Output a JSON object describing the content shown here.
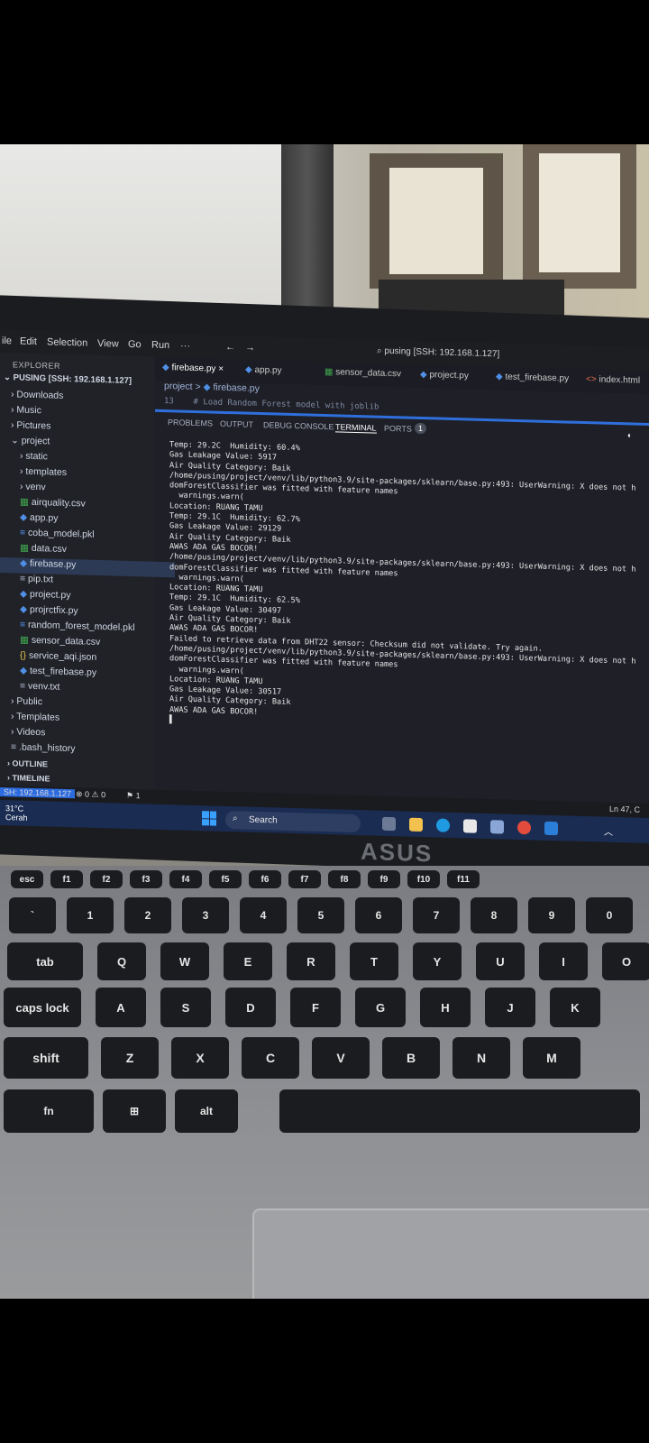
{
  "menubar": {
    "items": [
      "ile",
      "Edit",
      "Selection",
      "View",
      "Go",
      "Run",
      "···"
    ],
    "command_center": "pusing [SSH: 192.168.1.127]"
  },
  "explorer": {
    "title": "EXPLORER",
    "root": "PUSING [SSH: 192.168.1.127]",
    "items": [
      {
        "label": "Downloads",
        "kind": "folder",
        "indent": 1
      },
      {
        "label": "Music",
        "kind": "folder",
        "indent": 1
      },
      {
        "label": "Pictures",
        "kind": "folder",
        "indent": 1
      },
      {
        "label": "project",
        "kind": "folder-open",
        "indent": 1
      },
      {
        "label": "static",
        "kind": "folder",
        "indent": 2
      },
      {
        "label": "templates",
        "kind": "folder",
        "indent": 2
      },
      {
        "label": "venv",
        "kind": "folder",
        "indent": 2
      },
      {
        "label": "airquality.csv",
        "kind": "csv",
        "indent": 2
      },
      {
        "label": "app.py",
        "kind": "py",
        "indent": 2
      },
      {
        "label": "coba_model.pkl",
        "kind": "pkl",
        "indent": 2
      },
      {
        "label": "data.csv",
        "kind": "csv",
        "indent": 2
      },
      {
        "label": "firebase.py",
        "kind": "py",
        "indent": 2,
        "selected": true
      },
      {
        "label": "pip.txt",
        "kind": "txt",
        "indent": 2
      },
      {
        "label": "project.py",
        "kind": "py",
        "indent": 2
      },
      {
        "label": "projrctfix.py",
        "kind": "py",
        "indent": 2
      },
      {
        "label": "random_forest_model.pkl",
        "kind": "pkl",
        "indent": 2
      },
      {
        "label": "sensor_data.csv",
        "kind": "csv",
        "indent": 2
      },
      {
        "label": "service_aqi.json",
        "kind": "json",
        "indent": 2
      },
      {
        "label": "test_firebase.py",
        "kind": "py",
        "indent": 2
      },
      {
        "label": "venv.txt",
        "kind": "txt",
        "indent": 2
      },
      {
        "label": "Public",
        "kind": "folder",
        "indent": 1
      },
      {
        "label": "Templates",
        "kind": "folder",
        "indent": 1
      },
      {
        "label": "Videos",
        "kind": "folder",
        "indent": 1
      },
      {
        "label": ".bash_history",
        "kind": "txt",
        "indent": 1
      }
    ],
    "outline": "OUTLINE",
    "timeline": "TIMELINE"
  },
  "tabs": [
    {
      "label": "firebase.py",
      "active": true,
      "close": "×"
    },
    {
      "label": "app.py"
    },
    {
      "label": "sensor_data.csv"
    },
    {
      "label": "project.py"
    },
    {
      "label": "test_firebase.py"
    },
    {
      "label": "index.html"
    }
  ],
  "breadcrumb": {
    "root": "project",
    "sep": ">",
    "file": "firebase.py"
  },
  "editor_peek": "13    # Load Random Forest model with joblib",
  "panel": {
    "tabs": [
      "PROBLEMS",
      "OUTPUT",
      "DEBUG CONSOLE",
      "TERMINAL",
      "PORTS"
    ],
    "active": "TERMINAL",
    "ports_badge": "1"
  },
  "terminal_lines": [
    "Temp: 29.2C  Humidity: 60.4%",
    "Gas Leakage Value: 5917",
    "Air Quality Category: Baik",
    "/home/pusing/project/venv/lib/python3.9/site-packages/sklearn/base.py:493: UserWarning: X does not h",
    "domForestClassifier was fitted with feature names",
    "  warnings.warn(",
    "Location: RUANG TAMU",
    "Temp: 29.1C  Humidity: 62.7%",
    "Gas Leakage Value: 29129",
    "Air Quality Category: Baik",
    "AWAS ADA GAS BOCOR!",
    "/home/pusing/project/venv/lib/python3.9/site-packages/sklearn/base.py:493: UserWarning: X does not h",
    "domForestClassifier was fitted with feature names",
    "  warnings.warn(",
    "Location: RUANG TAMU",
    "Temp: 29.1C  Humidity: 62.5%",
    "Gas Leakage Value: 30497",
    "Air Quality Category: Baik",
    "AWAS ADA GAS BOCOR!",
    "Failed to retrieve data from DHT22 sensor: Checksum did not validate. Try again.",
    "/home/pusing/project/venv/lib/python3.9/site-packages/sklearn/base.py:493: UserWarning: X does not h",
    "domForestClassifier was fitted with feature names",
    "  warnings.warn(",
    "Location: RUANG TAMU",
    "Gas Leakage Value: 30517",
    "Air Quality Category: Baik",
    "AWAS ADA GAS BOCOR!",
    "▌"
  ],
  "statusbar": {
    "remote": "SH: 192.168.1.127",
    "problems": "⊗ 0 ⚠ 0",
    "ports": "⚑ 1",
    "position": "Ln 47, C"
  },
  "taskbar": {
    "weather_temp": "31°C",
    "weather_desc": "Cerah",
    "search": "Search"
  },
  "laptop_brand": "ASUS",
  "keys": {
    "fn_row": [
      "esc",
      "f1",
      "f2",
      "f3",
      "f4",
      "f5",
      "f6",
      "f7",
      "f8",
      "f9",
      "f10",
      "f11"
    ],
    "number_row": [
      "`",
      "1",
      "2",
      "3",
      "4",
      "5",
      "6",
      "7",
      "8",
      "9",
      "0"
    ],
    "qwerty_row": [
      "tab",
      "Q",
      "W",
      "E",
      "R",
      "T",
      "Y",
      "U",
      "I",
      "O"
    ],
    "home_row": [
      "caps lock",
      "A",
      "S",
      "D",
      "F",
      "G",
      "H",
      "J",
      "K"
    ],
    "shift_row": [
      "shift",
      "Z",
      "X",
      "C",
      "V",
      "B",
      "N",
      "M"
    ],
    "bottom_row": [
      "fn",
      "⊞",
      "alt"
    ]
  }
}
